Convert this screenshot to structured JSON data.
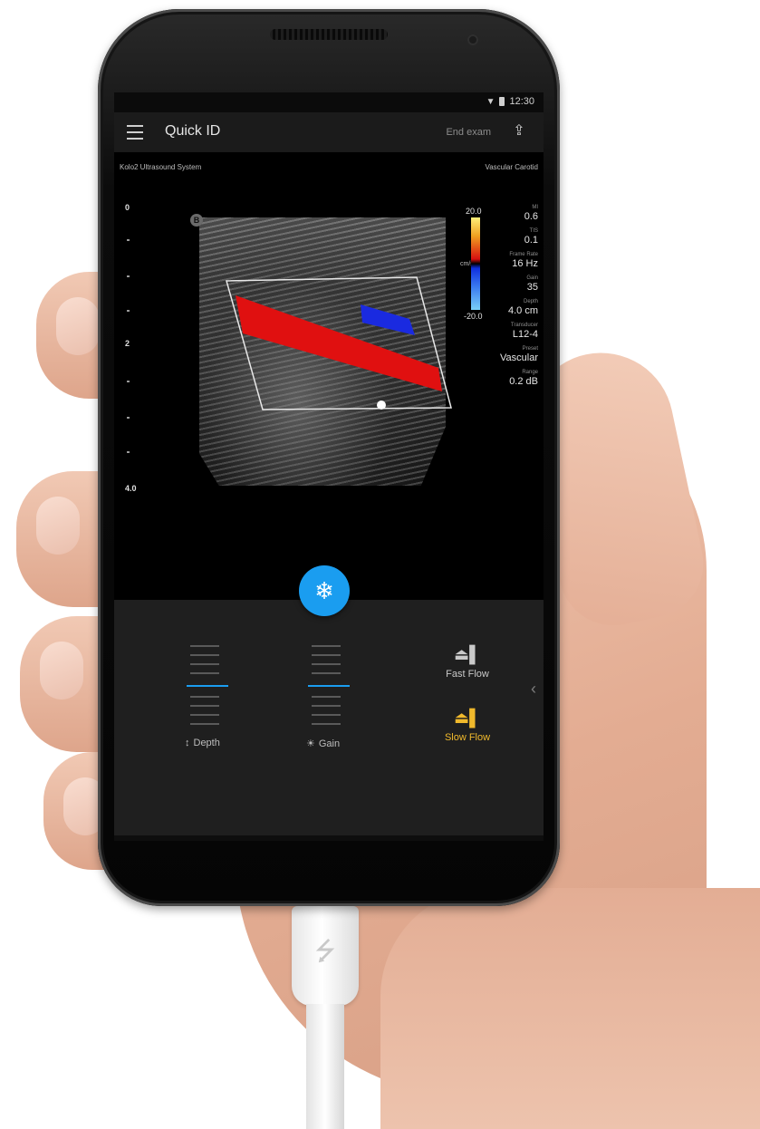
{
  "status_bar": {
    "time": "12:30"
  },
  "app_bar": {
    "title": "Quick ID",
    "end_exam": "End exam"
  },
  "screen_header": {
    "left": "Kolo2 Ultrasound System",
    "right": "Vascular Carotid"
  },
  "depth_scale": {
    "labels": [
      "0",
      "2",
      "4.0"
    ]
  },
  "image": {
    "b_mode_badge": "B"
  },
  "color_scale": {
    "top": "20.0",
    "bottom": "-20.0",
    "unit": "cm/s"
  },
  "parameters": [
    {
      "key": "MI",
      "value": "0.6"
    },
    {
      "key": "TIS",
      "value": "0.1"
    },
    {
      "key": "Frame Rate",
      "value": "16 Hz"
    },
    {
      "key": "Gain",
      "value": "35"
    },
    {
      "key": "Depth",
      "value": "4.0 cm"
    },
    {
      "key": "Transducer",
      "value": "L12-4"
    },
    {
      "key": "Preset",
      "value": "Vascular"
    },
    {
      "key": "Range",
      "value": "0.2 dB"
    }
  ],
  "controls": {
    "depth_label": "Depth",
    "gain_label": "Gain",
    "fast_flow_label": "Fast Flow",
    "slow_flow_label": "Slow Flow"
  },
  "colors": {
    "accent": "#1a9df0",
    "active_mode": "#f0b92c",
    "doppler_red": "#e01010",
    "doppler_blue": "#1a2ae0"
  },
  "icons": {
    "menu": "menu-icon",
    "export": "export-icon",
    "freeze": "snowflake-icon",
    "depth": "depth-icon",
    "gain": "gain-icon",
    "fast_flow": "fast-flow-icon",
    "slow_flow": "slow-flow-icon",
    "usb": "usb-icon"
  }
}
